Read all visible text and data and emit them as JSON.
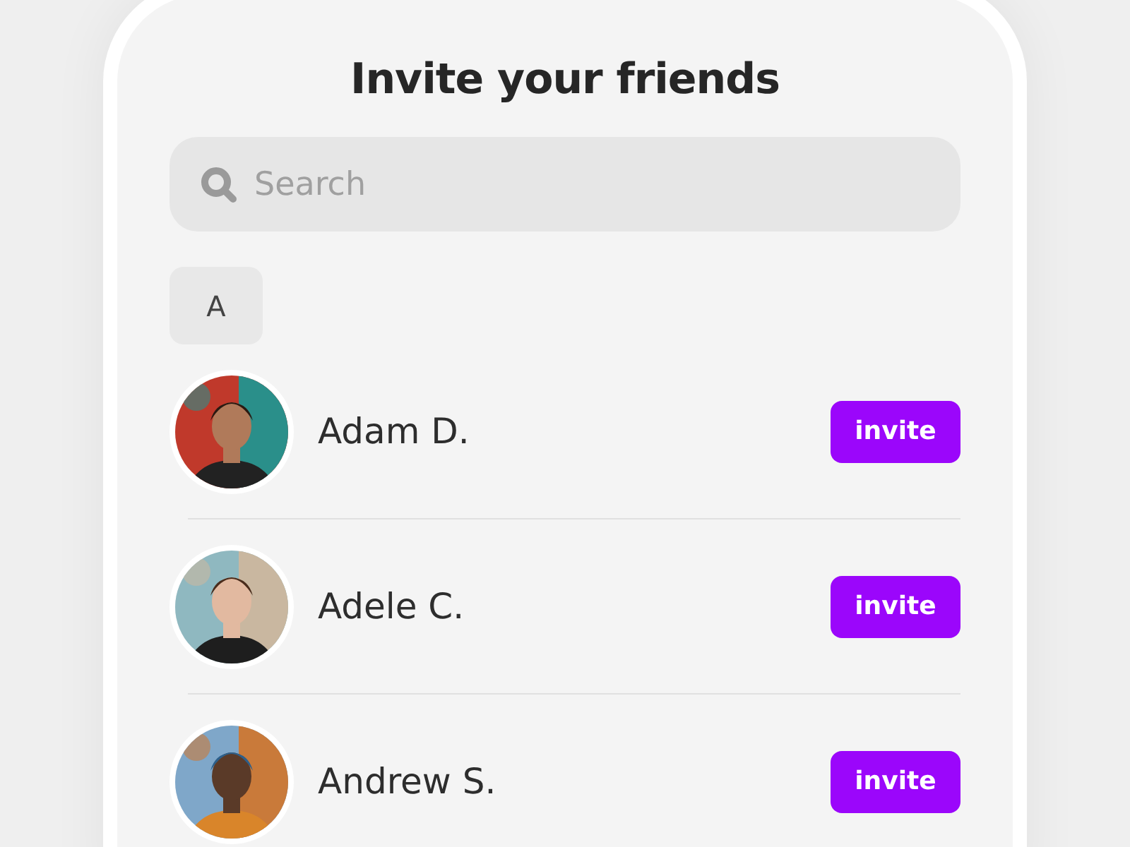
{
  "title": "Invite your friends",
  "search": {
    "placeholder": "Search"
  },
  "sections": [
    {
      "letter": "A",
      "contacts": [
        {
          "name": "Adam D.",
          "button": "invite"
        },
        {
          "name": "Adele C.",
          "button": "invite"
        },
        {
          "name": "Andrew S.",
          "button": "invite"
        }
      ]
    }
  ]
}
